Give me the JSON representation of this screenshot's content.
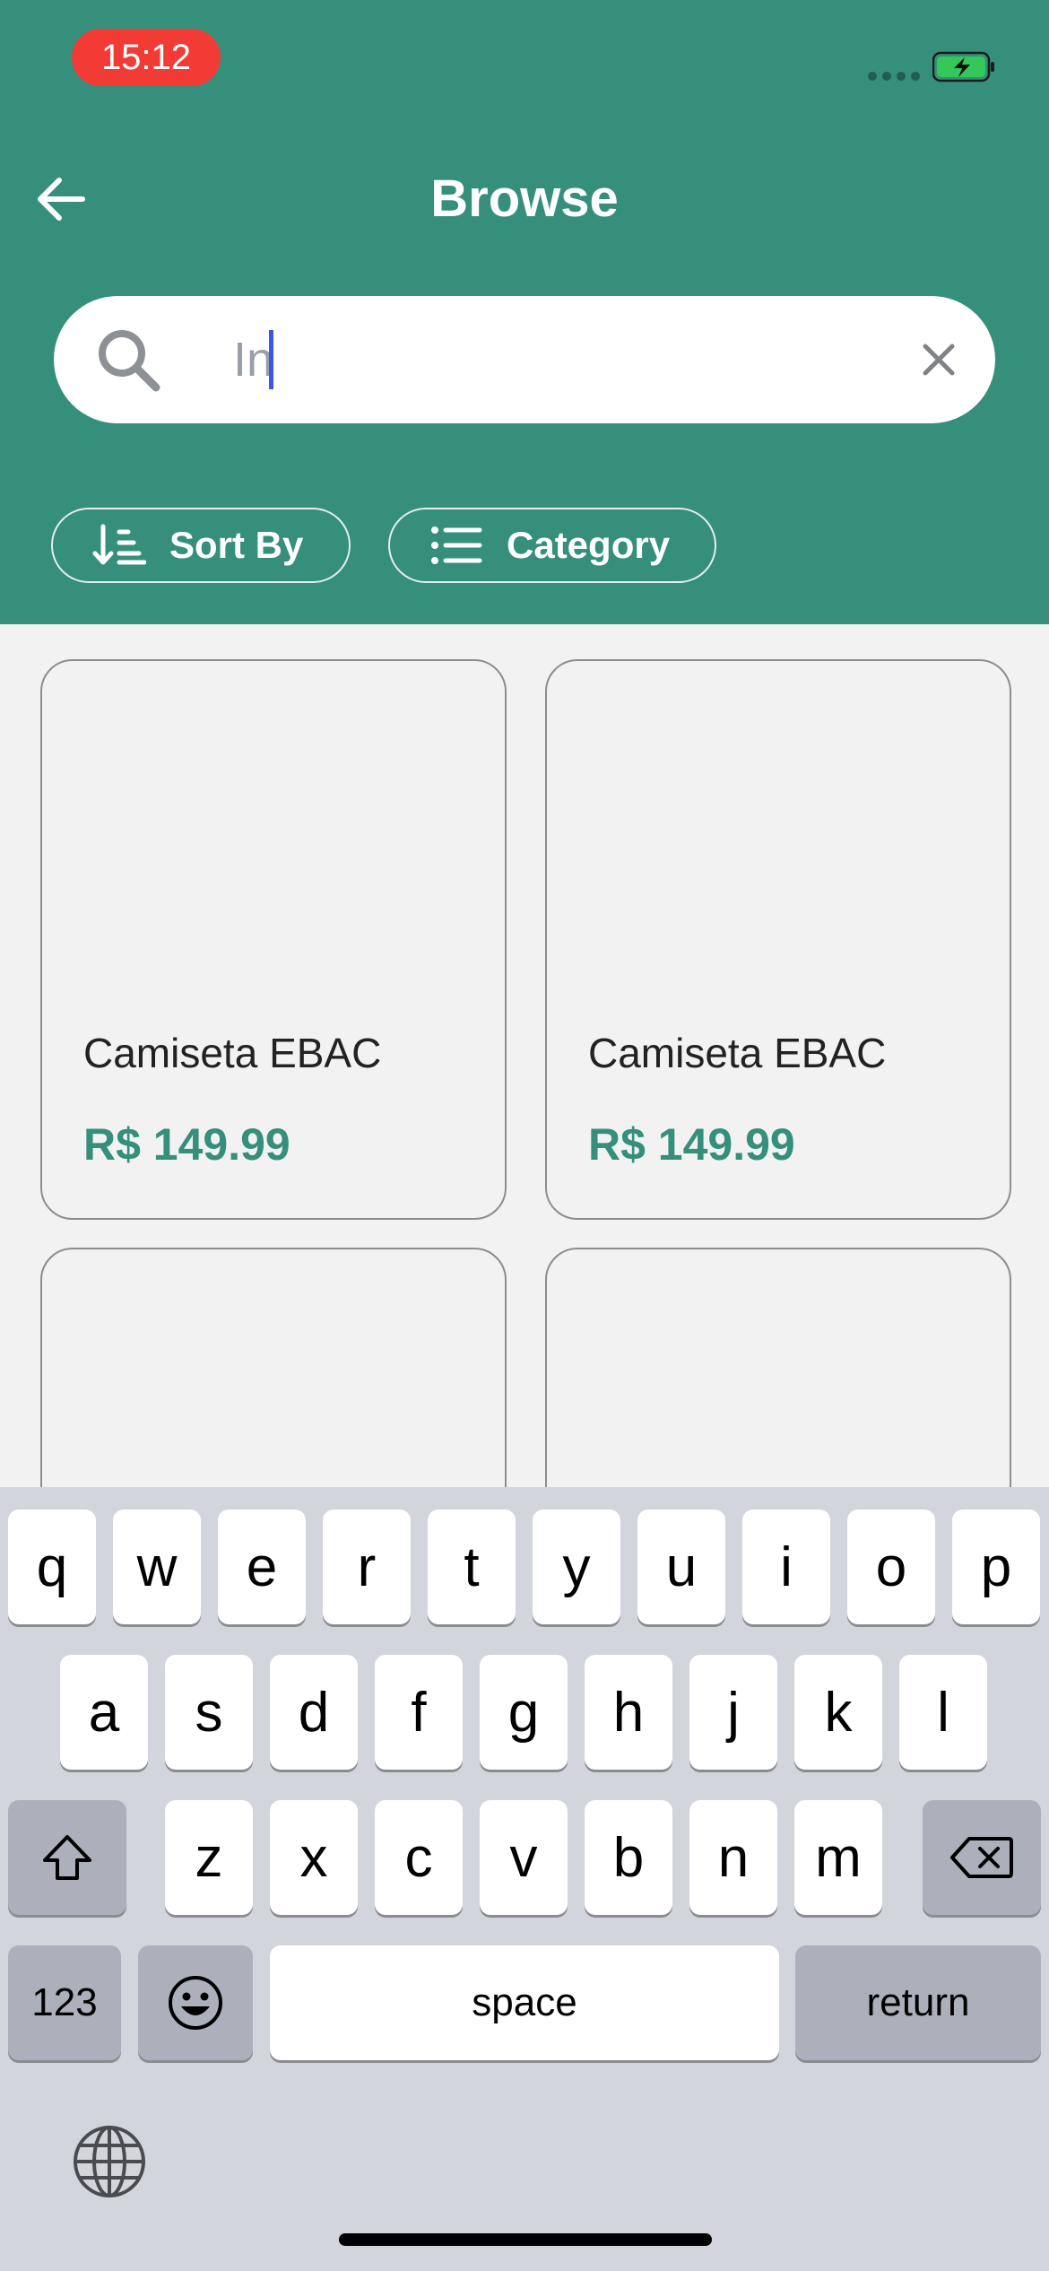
{
  "status_bar": {
    "time": "15:12"
  },
  "header": {
    "title": "Browse"
  },
  "search": {
    "value": "In"
  },
  "filters": {
    "sort_label": "Sort By",
    "category_label": "Category"
  },
  "products": [
    {
      "name": "Camiseta EBAC",
      "price": "R$ 149.99"
    },
    {
      "name": "Camiseta EBAC",
      "price": "R$ 149.99"
    },
    {
      "name": "",
      "price": ""
    },
    {
      "name": "",
      "price": ""
    }
  ],
  "keyboard": {
    "row1": [
      "q",
      "w",
      "e",
      "r",
      "t",
      "y",
      "u",
      "i",
      "o",
      "p"
    ],
    "row2": [
      "a",
      "s",
      "d",
      "f",
      "g",
      "h",
      "j",
      "k",
      "l"
    ],
    "row3": [
      "z",
      "x",
      "c",
      "v",
      "b",
      "n",
      "m"
    ],
    "numbers_label": "123",
    "space_label": "space",
    "return_label": "return"
  },
  "colors": {
    "brand": "#358f7b",
    "time_pill": "#f23b35",
    "caret": "#3c56e6"
  },
  "icons": [
    "back-arrow-icon",
    "search-icon",
    "clear-icon",
    "sort-icon",
    "list-icon",
    "shift-icon",
    "delete-icon",
    "emoji-icon",
    "globe-icon",
    "battery-icon"
  ]
}
